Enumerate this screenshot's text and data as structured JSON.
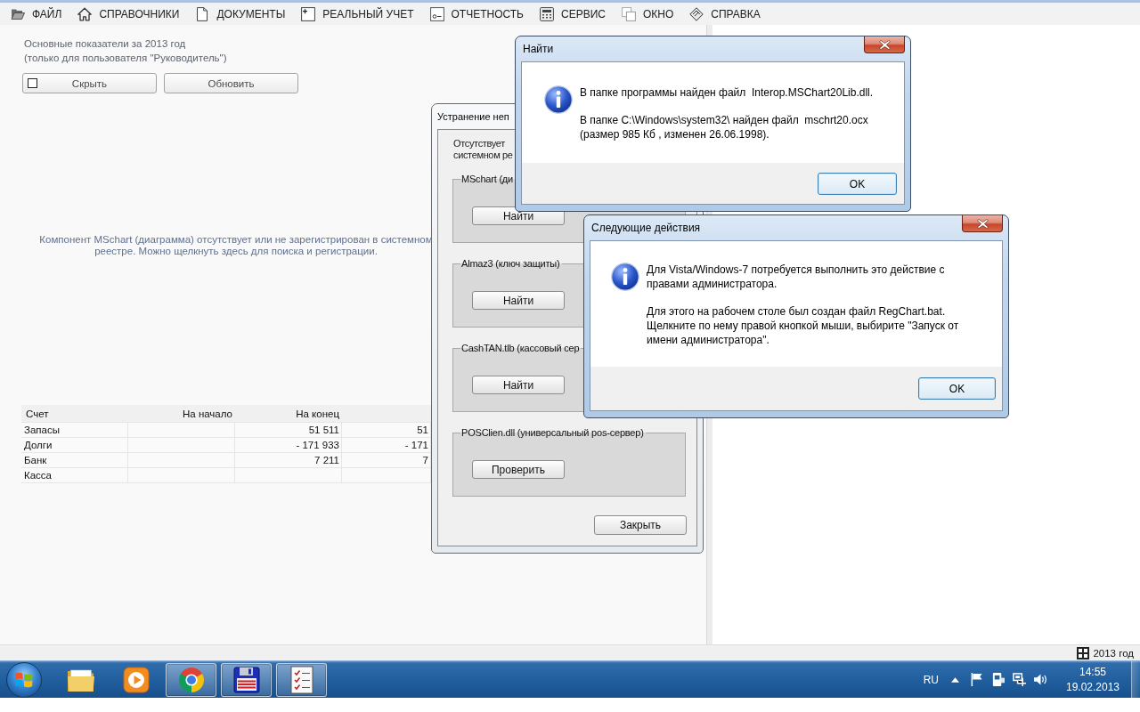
{
  "menu": [
    {
      "label": "ФАЙЛ"
    },
    {
      "label": "СПРАВОЧНИКИ"
    },
    {
      "label": "ДОКУМЕНТЫ"
    },
    {
      "label": "РЕАЛЬНЫЙ УЧЕТ"
    },
    {
      "label": "ОТЧЕТНОСТЬ"
    },
    {
      "label": "СЕРВИС"
    },
    {
      "label": "ОКНО"
    },
    {
      "label": "СПРАВКА"
    }
  ],
  "dashboard": {
    "title": "Основные показатели за 2013 год",
    "subtitle": "(только для пользователя \"Руководитель\")",
    "hide_toggle": {
      "label": "Скрыть",
      "checked": false
    },
    "refresh_button": {
      "label": "Обновить"
    },
    "chart_message": "Компонент MSchart (диаграмма) отсутствует или не зарегистрирован в системном\nреестре. Можно щелкнуть здесь для поиска и регистрации.",
    "table": {
      "columns": [
        {
          "label": "Счет"
        },
        {
          "label": "На начало"
        },
        {
          "label": "На конец"
        }
      ],
      "rows": [
        {
          "account": "Запасы",
          "at_end": "51 511",
          "column_4": "51"
        },
        {
          "account": "Долги",
          "at_end": "- 171 933",
          "column_4": "- 171"
        },
        {
          "account": "Банк",
          "at_end": "7 211",
          "column_4": "7"
        },
        {
          "account": "Касса"
        }
      ]
    }
  },
  "troubleshoot_dialog": {
    "title": "Устранение неп",
    "intro": "Отсутствует\nсистемном ре",
    "groups": [
      {
        "title": "MSchart (ди",
        "button": "Найти"
      },
      {
        "title": "Almaz3 (ключ защиты)",
        "button": "Найти"
      },
      {
        "title": "CashTAN.tlb (кассовый сер",
        "button": "Найти"
      },
      {
        "title": "POSClien.dll (универсальный pos-сервер)",
        "button": "Проверить"
      }
    ],
    "close_button": "Закрыть"
  },
  "find_dialog": {
    "title": "Найти",
    "paragraphs": [
      "В папке программы найден файл  Interop.MSChart20Lib.dll.",
      "В папке C:\\Windows\\system32\\ найден файл  mschrt20.ocx\n(размер 985 Кб , изменен 26.06.1998)."
    ],
    "ok_button": "OK"
  },
  "next_steps_dialog": {
    "title": "Следующие действия",
    "paragraphs": [
      "Для Vista/Windows-7 потребуется выполнить это действие с\nправами администратора.",
      "Для этого на рабочем столе был создан файл RegChart.bat.\nЩелкните по нему правой кнопкой мыши, выбирите \"Запуск от\nимени администратора\"."
    ],
    "ok_button": "OK"
  },
  "status_bar": {
    "period": "2013 год"
  },
  "taskbar": {
    "apps": [
      {
        "running": false
      },
      {
        "running": false
      },
      {
        "running": true
      },
      {
        "running": true
      },
      {
        "running": true
      }
    ],
    "language": "RU",
    "time": "14:55",
    "date": "19.02.2013"
  }
}
